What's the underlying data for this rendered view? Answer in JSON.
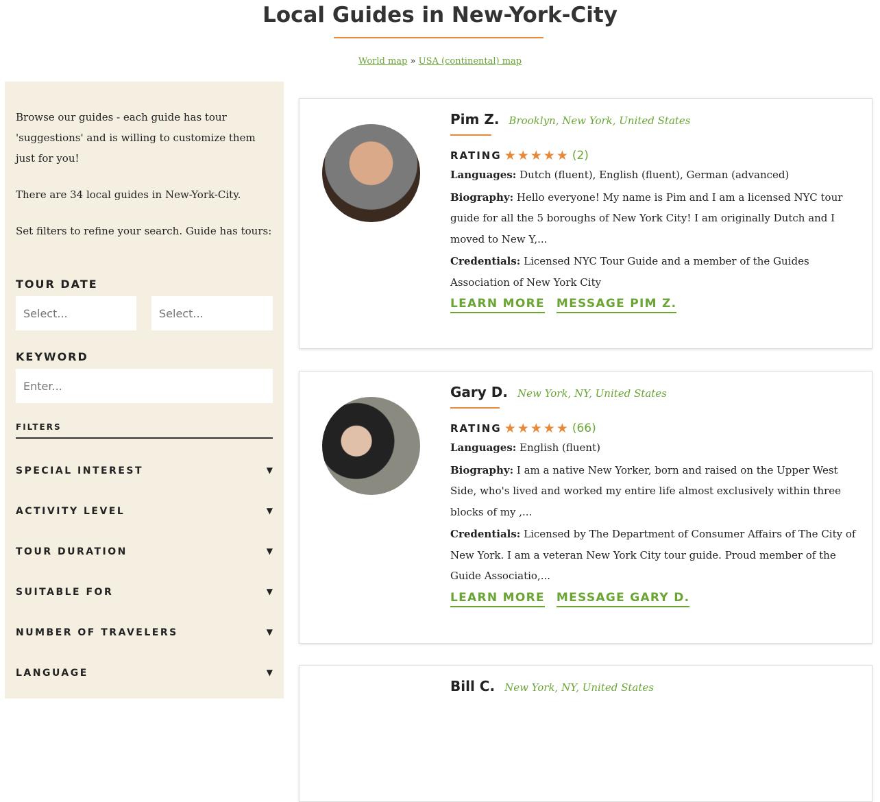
{
  "page": {
    "title": "Local Guides in New-York-City"
  },
  "breadcrumb": {
    "world": "World map",
    "sep": "»",
    "usa": "USA (continental) map"
  },
  "sidebar": {
    "intro": "Browse our guides - each guide has tour 'suggestions' and is willing to customize them just for you!",
    "count": "There are 34 local guides in New-York-City.",
    "set_filters": "Set filters to refine your search. Guide has tours:",
    "tour_date_label": "TOUR DATE",
    "date_from_placeholder": "Select...",
    "date_to_placeholder": "Select...",
    "keyword_label": "KEYWORD",
    "keyword_placeholder": "Enter...",
    "filters_heading": "FILTERS",
    "filters": [
      {
        "label": "SPECIAL INTEREST"
      },
      {
        "label": "ACTIVITY LEVEL"
      },
      {
        "label": "TOUR DURATION"
      },
      {
        "label": "SUITABLE FOR"
      },
      {
        "label": "NUMBER OF TRAVELERS"
      },
      {
        "label": "LANGUAGE"
      }
    ],
    "arrow": "▼"
  },
  "guides": [
    {
      "name": "Pim Z.",
      "location": "Brooklyn, New York, United States",
      "rating_label": "RATING",
      "stars": 5,
      "star_text": "★★★★★",
      "reviews": "(2)",
      "languages_label": "Languages:",
      "languages": "Dutch (fluent), English (fluent), German (advanced)",
      "bio_label": "Biography:",
      "bio": "Hello everyone! My name is Pim and I am a licensed NYC tour guide for all the 5 boroughs of New York City! I am originally Dutch and I moved to New Y,...",
      "cred_label": "Credentials:",
      "cred": "Licensed NYC Tour Guide and a member of the Guides Association of New York City",
      "learn": "LEARN MORE",
      "message": "MESSAGE PIM Z."
    },
    {
      "name": "Gary D.",
      "location": "New York, NY, United States",
      "rating_label": "RATING",
      "stars": 5,
      "star_text": "★★★★★",
      "reviews": "(66)",
      "languages_label": "Languages:",
      "languages": "English (fluent)",
      "bio_label": "Biography:",
      "bio": "I am a native New Yorker, born and raised on the Upper West Side, who's lived and worked my entire life almost exclusively within three blocks of my ,...",
      "cred_label": "Credentials:",
      "cred": "Licensed by The Department of Consumer Affairs of The City of New York. I am a veteran New York City tour guide. Proud member of the Guide Associatio,...",
      "learn": "LEARN MORE",
      "message": "MESSAGE GARY D."
    },
    {
      "name": "Bill C.",
      "location": "New York, NY, United States"
    }
  ],
  "colors": {
    "accent_green": "#6aa534",
    "accent_orange": "#e8893a",
    "sidebar_bg": "#f4efe1"
  }
}
